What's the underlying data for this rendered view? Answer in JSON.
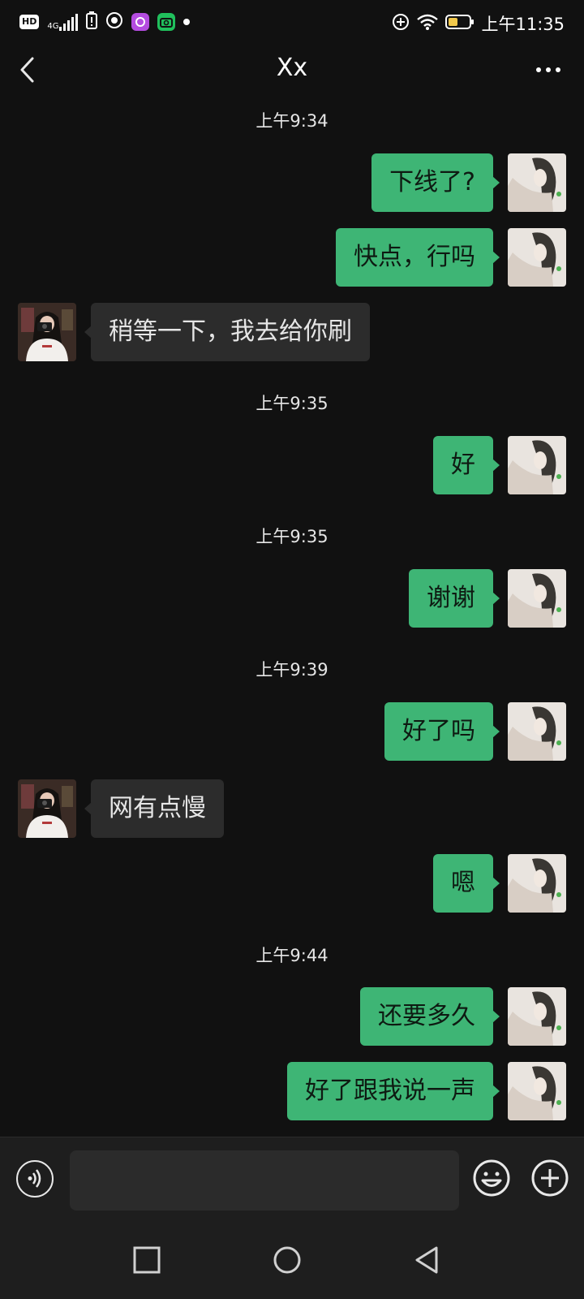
{
  "status_bar": {
    "hd": "HD",
    "network": "4G",
    "time": "上午11:35",
    "icons": [
      "hd-icon",
      "signal-icon",
      "battery-alert-icon",
      "record-icon",
      "app-icon",
      "camera-app-icon",
      "dot-icon",
      "add-circle-icon",
      "wifi-icon",
      "battery-icon"
    ]
  },
  "header": {
    "title": "Xx",
    "back_icon": "chevron-left-icon",
    "more_icon": "more-dots-icon"
  },
  "colors": {
    "background": "#111111",
    "sent_bubble": "#3eb575",
    "received_bubble": "#2c2c2c"
  },
  "messages": [
    {
      "type": "time",
      "text": "上午9:34"
    },
    {
      "type": "sent",
      "text": "下线了?"
    },
    {
      "type": "sent",
      "text": "快点，行吗"
    },
    {
      "type": "received",
      "text": "稍等一下，我去给你刷"
    },
    {
      "type": "time",
      "text": "上午9:35"
    },
    {
      "type": "sent",
      "text": "好"
    },
    {
      "type": "time",
      "text": "上午9:35"
    },
    {
      "type": "sent",
      "text": "谢谢"
    },
    {
      "type": "time",
      "text": "上午9:39"
    },
    {
      "type": "sent",
      "text": "好了吗"
    },
    {
      "type": "received",
      "text": "网有点慢"
    },
    {
      "type": "sent",
      "text": "嗯"
    },
    {
      "type": "time",
      "text": "上午9:44"
    },
    {
      "type": "sent",
      "text": "还要多久"
    },
    {
      "type": "sent",
      "text": "好了跟我说一声"
    }
  ],
  "input_bar": {
    "voice_icon": "voice-icon",
    "text_value": "",
    "emoji_icon": "emoji-icon",
    "plus_icon": "plus-circle-icon"
  },
  "nav_bar": {
    "icons": [
      "recent-apps-icon",
      "home-icon",
      "back-icon"
    ]
  }
}
